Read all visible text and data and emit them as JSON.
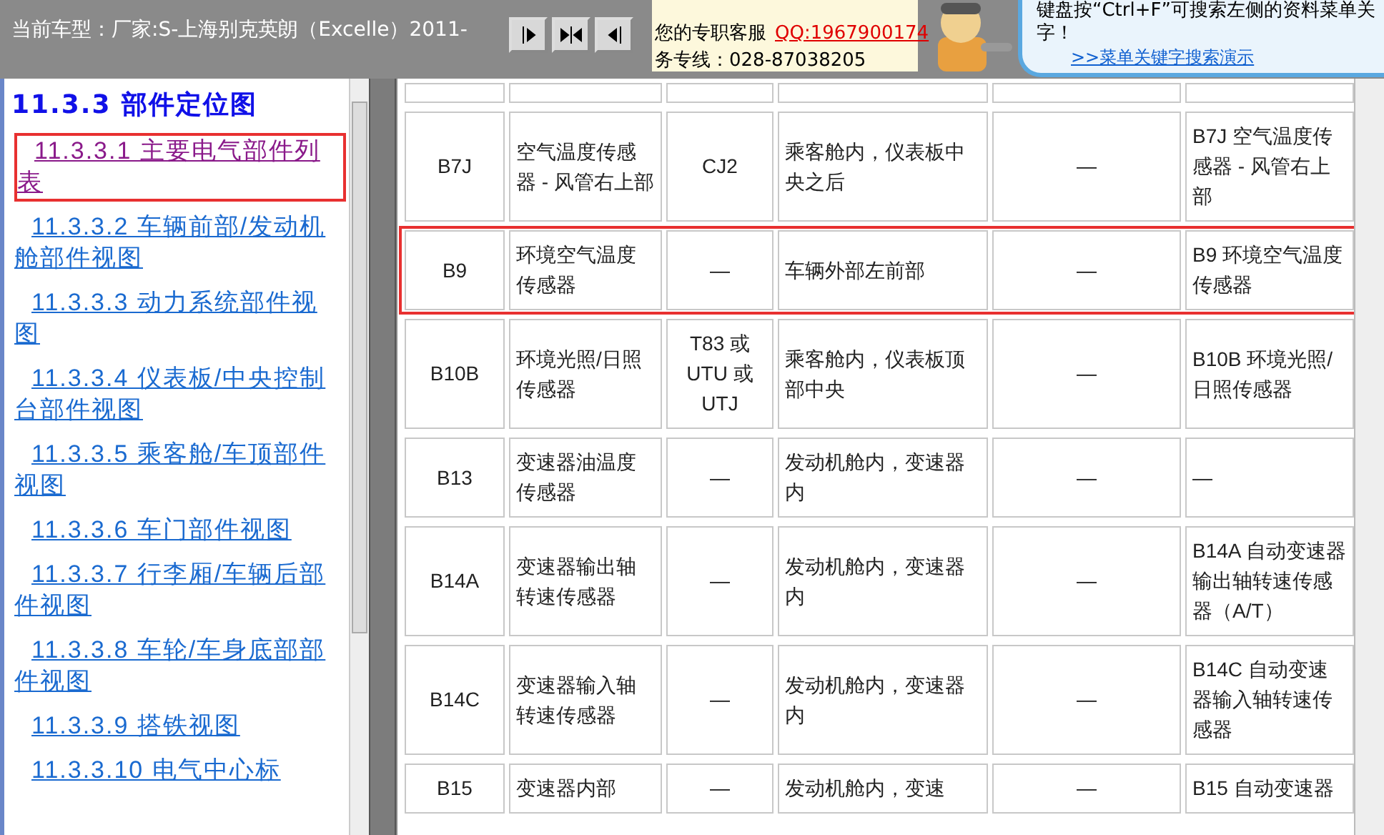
{
  "top_bar": {
    "current_model": "当前车型：厂家:S-上海别克英朗（Excelle）2011-",
    "buttons": [
      {
        "kind": "expand"
      },
      {
        "kind": "both"
      },
      {
        "kind": "collapse"
      }
    ],
    "service": {
      "label": "您的专职客服",
      "qq": "QQ:1967900174",
      "hotline": "务专线：028-87038205"
    },
    "tip": {
      "lines": [
        "键盘按“Ctrl+F”可搜索左侧的资料菜单关",
        "字！"
      ],
      "link": ">>菜单关键字搜索演示"
    }
  },
  "sidebar": {
    "heading": "11.3.3 部件定位图",
    "items": [
      {
        "label": "11.3.3.1 主要电气部件列表",
        "visited": true,
        "highlighted": true
      },
      {
        "label": "11.3.3.2 车辆前部/发动机舱部件视图",
        "visited": false,
        "highlighted": false
      },
      {
        "label": "11.3.3.3 动力系统部件视图",
        "visited": false,
        "highlighted": false
      },
      {
        "label": "11.3.3.4 仪表板/中央控制台部件视图",
        "visited": false,
        "highlighted": false
      },
      {
        "label": "11.3.3.5 乘客舱/车顶部件视图",
        "visited": false,
        "highlighted": false
      },
      {
        "label": "11.3.3.6 车门部件视图",
        "visited": false,
        "highlighted": false
      },
      {
        "label": "11.3.3.7 行李厢/车辆后部件视图",
        "visited": false,
        "highlighted": false
      },
      {
        "label": "11.3.3.8 车轮/车身底部部件视图",
        "visited": false,
        "highlighted": false
      },
      {
        "label": "11.3.3.9 搭铁视图",
        "visited": false,
        "highlighted": false
      },
      {
        "label": "11.3.3.10 电气中心标",
        "visited": false,
        "highlighted": false
      }
    ]
  },
  "table": {
    "rows": [
      {
        "highlighted": false,
        "cells": [
          "",
          "",
          "",
          "",
          "",
          ""
        ]
      },
      {
        "highlighted": false,
        "cells": [
          "B7J",
          "空气温度传感器 - 风管右上部",
          "CJ2",
          "乘客舱内，仪表板中央之后",
          "—",
          "B7J 空气温度传感器 - 风管右上部"
        ]
      },
      {
        "highlighted": true,
        "cells": [
          "B9",
          "环境空气温度传感器",
          "—",
          "车辆外部左前部",
          "—",
          "B9 环境空气温度传感器"
        ]
      },
      {
        "highlighted": false,
        "cells": [
          "B10B",
          "环境光照/日照传感器",
          "T83 或 UTU 或 UTJ",
          "乘客舱内，仪表板顶部中央",
          "—",
          "B10B 环境光照/日照传感器"
        ]
      },
      {
        "highlighted": false,
        "cells": [
          "B13",
          "变速器油温度传感器",
          "—",
          "发动机舱内，变速器内",
          "—",
          "—"
        ]
      },
      {
        "highlighted": false,
        "cells": [
          "B14A",
          "变速器输出轴转速传感器",
          "—",
          "发动机舱内，变速器内",
          "—",
          "B14A 自动变速器输出轴转速传感器（A/T）"
        ]
      },
      {
        "highlighted": false,
        "cells": [
          "B14C",
          "变速器输入轴转速传感器",
          "—",
          "发动机舱内，变速器内",
          "—",
          "B14C 自动变速器输入轴转速传感器"
        ]
      },
      {
        "highlighted": false,
        "cells": [
          "B15",
          "变速器内部",
          "—",
          "发动机舱内，变速",
          "—",
          "B15 自动变速器"
        ]
      }
    ]
  }
}
